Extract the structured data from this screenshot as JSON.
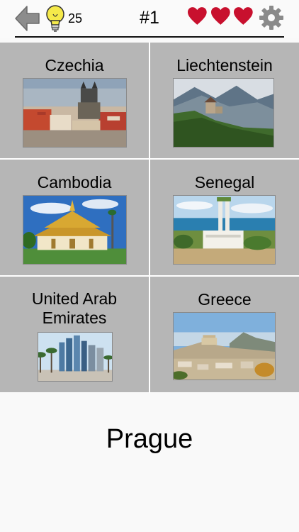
{
  "header": {
    "hint_count": "25",
    "question_number": "#1",
    "lives_icon": "heart-icon",
    "lives_count": 3,
    "heart_color": "#c8102e"
  },
  "options": [
    {
      "name": "Czechia",
      "photo": "prague-old-town-photo"
    },
    {
      "name": "Liechtenstein",
      "photo": "vaduz-castle-photo"
    },
    {
      "name": "Cambodia",
      "photo": "cambodian-temple-photo"
    },
    {
      "name": "Senegal",
      "photo": "dakar-mosque-photo"
    },
    {
      "name": "United Arab Emirates",
      "photo": "abu-dhabi-skyline-photo"
    },
    {
      "name": "Greece",
      "photo": "athens-acropolis-photo"
    }
  ],
  "question": {
    "capital": "Prague"
  }
}
